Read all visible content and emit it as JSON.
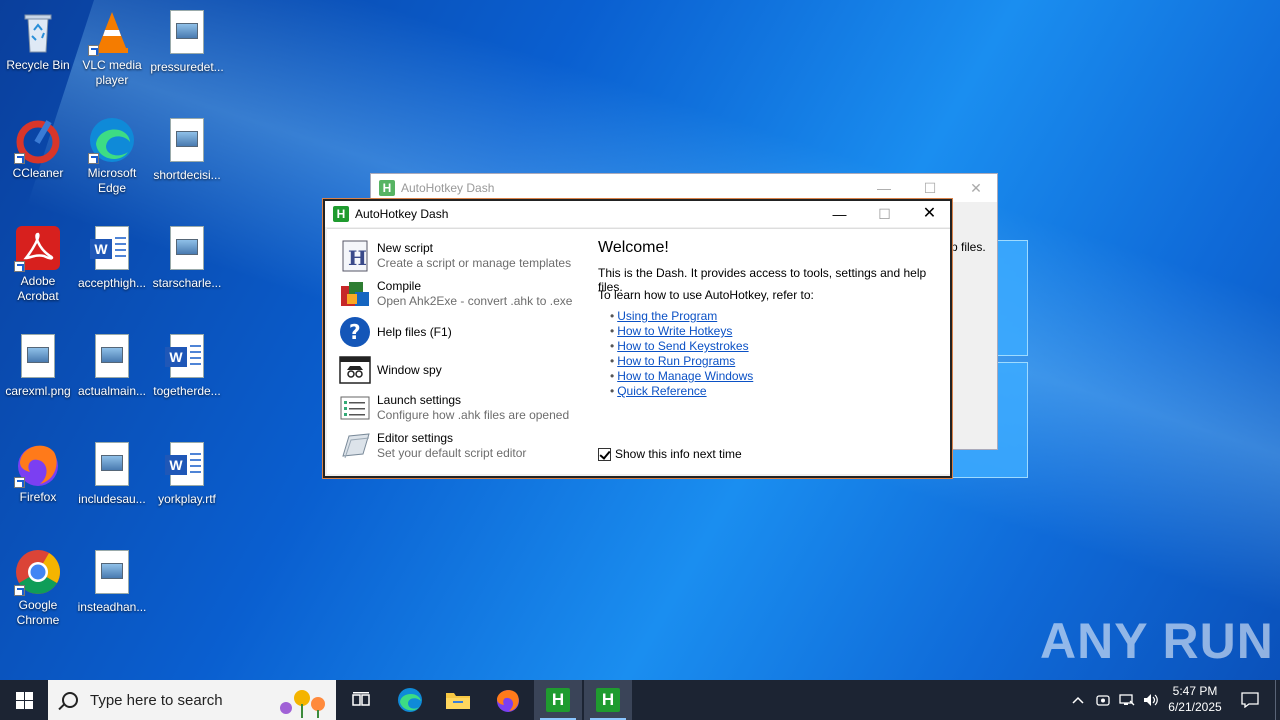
{
  "desktop": {
    "icons": [
      {
        "label": "Recycle Bin",
        "icon": "recycle-bin-icon"
      },
      {
        "label": "VLC media player",
        "icon": "vlc-icon"
      },
      {
        "label": "pressuredet...",
        "icon": "image-file-icon"
      },
      {
        "label": "CCleaner",
        "icon": "ccleaner-icon"
      },
      {
        "label": "Microsoft Edge",
        "icon": "edge-icon"
      },
      {
        "label": "shortdecisi...",
        "icon": "image-file-icon"
      },
      {
        "label": "Adobe Acrobat",
        "icon": "acrobat-icon"
      },
      {
        "label": "accepthigh...",
        "icon": "word-file-icon"
      },
      {
        "label": "starscharle...",
        "icon": "image-file-icon"
      },
      {
        "label": "carexml.png",
        "icon": "image-file-icon"
      },
      {
        "label": "actualmain...",
        "icon": "image-file-icon"
      },
      {
        "label": "togetherde...",
        "icon": "word-file-icon"
      },
      {
        "label": "Firefox",
        "icon": "firefox-icon"
      },
      {
        "label": "includesau...",
        "icon": "image-file-icon"
      },
      {
        "label": "yorkplay.rtf",
        "icon": "word-file-icon"
      },
      {
        "label": "Google Chrome",
        "icon": "chrome-icon"
      },
      {
        "label": "insteadhan...",
        "icon": "image-file-icon"
      }
    ]
  },
  "background_window": {
    "title": "AutoHotkey Dash",
    "peek_text": "p files."
  },
  "main_window": {
    "title": "AutoHotkey Dash",
    "menu": [
      {
        "title": "New script",
        "subtitle": "Create a script or manage templates",
        "icon": "new-script-icon"
      },
      {
        "title": "Compile",
        "subtitle": "Open Ahk2Exe - convert .ahk to .exe",
        "icon": "compile-icon"
      },
      {
        "title": "Help files (F1)",
        "subtitle": "",
        "icon": "help-icon"
      },
      {
        "title": "Window spy",
        "subtitle": "",
        "icon": "window-spy-icon"
      },
      {
        "title": "Launch settings",
        "subtitle": "Configure how .ahk files are opened",
        "icon": "launch-settings-icon"
      },
      {
        "title": "Editor settings",
        "subtitle": "Set your default script editor",
        "icon": "editor-settings-icon"
      }
    ],
    "welcome": "Welcome!",
    "intro": "This is the Dash. It provides access to tools, settings and help files.",
    "learn": "To learn how to use AutoHotkey, refer to:",
    "links": [
      "Using the Program",
      "How to Write Hotkeys",
      "How to Send Keystrokes",
      "How to Run Programs",
      "How to Manage Windows",
      "Quick Reference"
    ],
    "checkbox_label": "Show this info next time",
    "checkbox_checked": true
  },
  "watermark": "ANY RUN",
  "taskbar": {
    "search_placeholder": "Type here to search",
    "time": "5:47 PM",
    "date": "6/21/2025",
    "pinned": [
      "task-view-icon",
      "edge-icon",
      "file-explorer-icon",
      "firefox-icon",
      "autohotkey-icon",
      "autohotkey-icon"
    ]
  },
  "colors": {
    "link": "#0b51c5",
    "ahk_green": "#1f9b2f",
    "taskbar": "#1c2433"
  }
}
